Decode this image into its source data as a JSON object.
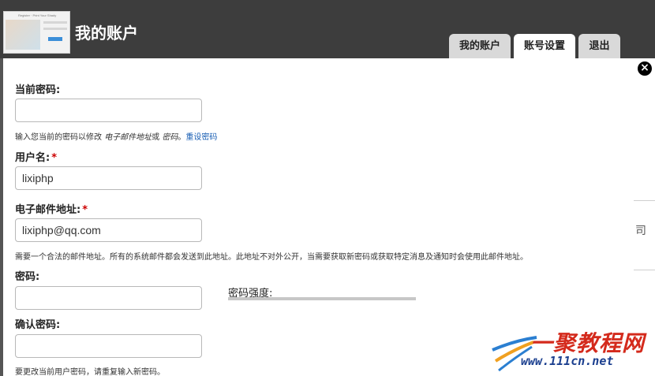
{
  "header": {
    "title": "我的账户",
    "thumbnail_title": "Register · Print Your Shady"
  },
  "tabs": [
    {
      "label": "我的账户",
      "active": false
    },
    {
      "label": "账号设置",
      "active": true
    },
    {
      "label": "退出",
      "active": false
    }
  ],
  "modal": {
    "close_icon": "×",
    "current_password": {
      "label": "当前密码:",
      "value": "",
      "help_prefix": "输入您当前的密码以修改 ",
      "help_em": "电子邮件地址",
      "help_mid": "或 ",
      "help_em2": "密码",
      "help_sep": "。",
      "help_link": "重设密码"
    },
    "username": {
      "label": "用户名:",
      "required_mark": "*",
      "value": "lixiphp"
    },
    "email": {
      "label": "电子邮件地址:",
      "required_mark": "*",
      "value": "lixiphp@qq.com",
      "help": "需要一个合法的邮件地址。所有的系统邮件都会发送到此地址。此地址不对外公开，当需要获取新密码或获取特定消息及通知时会使用此邮件地址。"
    },
    "password": {
      "label": "密码:",
      "value": "",
      "strength_label": "密码强度:"
    },
    "confirm_password": {
      "label": "确认密码:",
      "value": "",
      "help": "要更改当前用户密码，请重复输入新密码。"
    }
  },
  "backdrop": {
    "partial_char": "司"
  },
  "watermark": {
    "text": "一聚教程网",
    "url": "www.111cn.net"
  },
  "colors": {
    "header_bg": "#3d3d3d",
    "required": "#cc0000",
    "link": "#1a5fb4"
  }
}
